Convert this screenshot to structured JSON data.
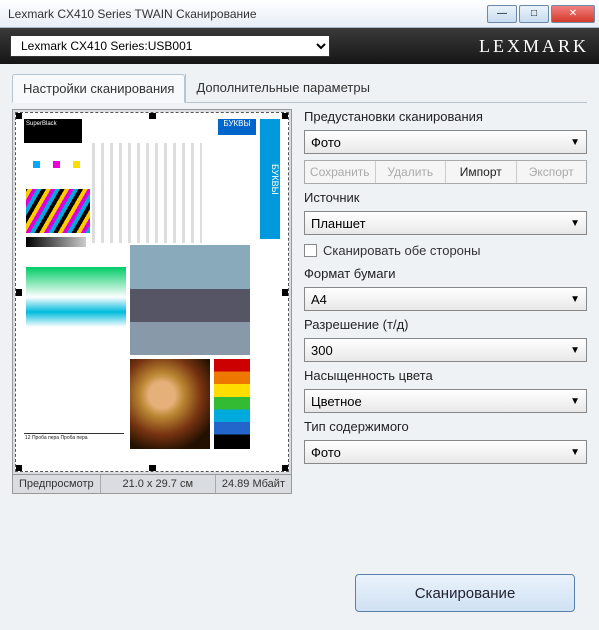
{
  "window": {
    "title": "Lexmark CX410 Series TWAIN Сканирование"
  },
  "topbar": {
    "device": "Lexmark CX410 Series:USB001",
    "brand": "LEXMARK"
  },
  "tabs": {
    "settings": "Настройки сканирования",
    "advanced": "Дополнительные параметры"
  },
  "preview": {
    "label": "Предпросмотр",
    "dims": "21.0 x 29.7 см",
    "size": "24.89 Мбайт"
  },
  "settings": {
    "preset_label": "Предустановки сканирования",
    "preset_value": "Фото",
    "buttons": {
      "save": "Сохранить",
      "delete": "Удалить",
      "import": "Импорт",
      "export": "Экспорт"
    },
    "source_label": "Источник",
    "source_value": "Планшет",
    "duplex": "Сканировать обе стороны",
    "paper_label": "Формат бумаги",
    "paper_value": "A4",
    "dpi_label": "Разрешение (т/д)",
    "dpi_value": "300",
    "color_label": "Насыщенность цвета",
    "color_value": "Цветное",
    "content_label": "Тип содержимого",
    "content_value": "Фото"
  },
  "scan_button": "Сканирование",
  "thumb_text": {
    "bukvy": "БУКВЫ"
  }
}
